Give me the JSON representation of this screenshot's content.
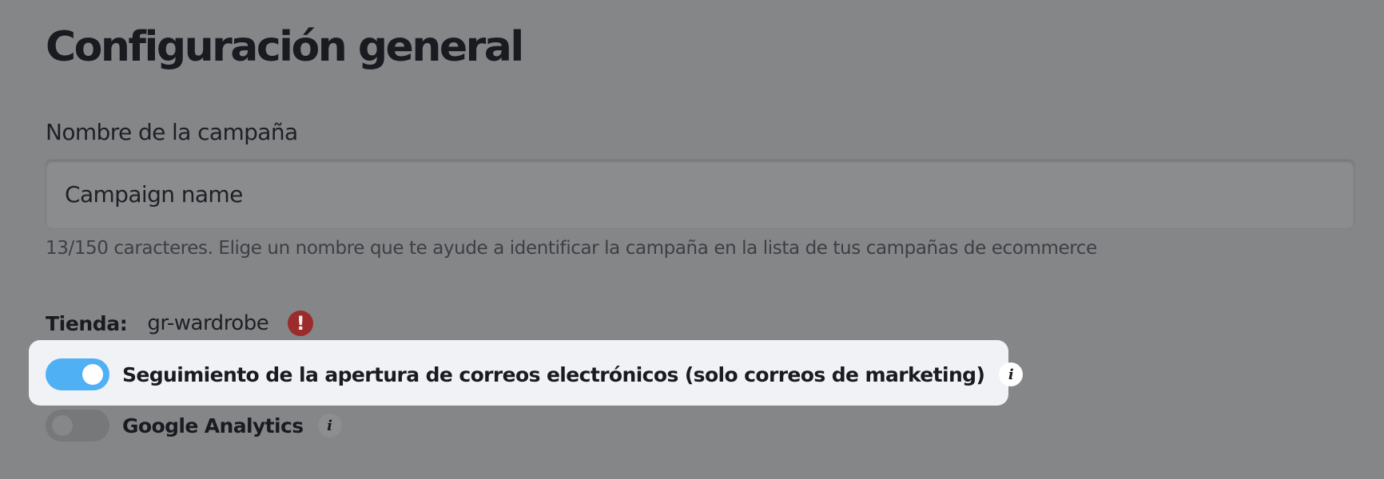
{
  "page": {
    "title": "Configuración general"
  },
  "campaign_name": {
    "label": "Nombre de la campaña",
    "value": "",
    "placeholder": "Campaign name",
    "hint": "13/150 caracteres. Elige un nombre que te ayude a identificar la campaña en la lista de tus campañas de ecommerce"
  },
  "store": {
    "label": "Tienda:",
    "value": "gr-wardrobe",
    "warning_icon": "exclamation-icon",
    "warning_glyph": "!",
    "warning_color": "#9c2b2b"
  },
  "toggles": [
    {
      "label": "Seguimiento de la apertura de correos electrónicos (solo correos de marketing)",
      "enabled": true,
      "info_icon": "info-icon",
      "info_glyph": "i",
      "accent_color": "#4fb0f4",
      "highlighted": true
    },
    {
      "label": "Google Analytics",
      "enabled": false,
      "info_icon": "info-icon",
      "info_glyph": "i",
      "highlighted": false
    }
  ]
}
